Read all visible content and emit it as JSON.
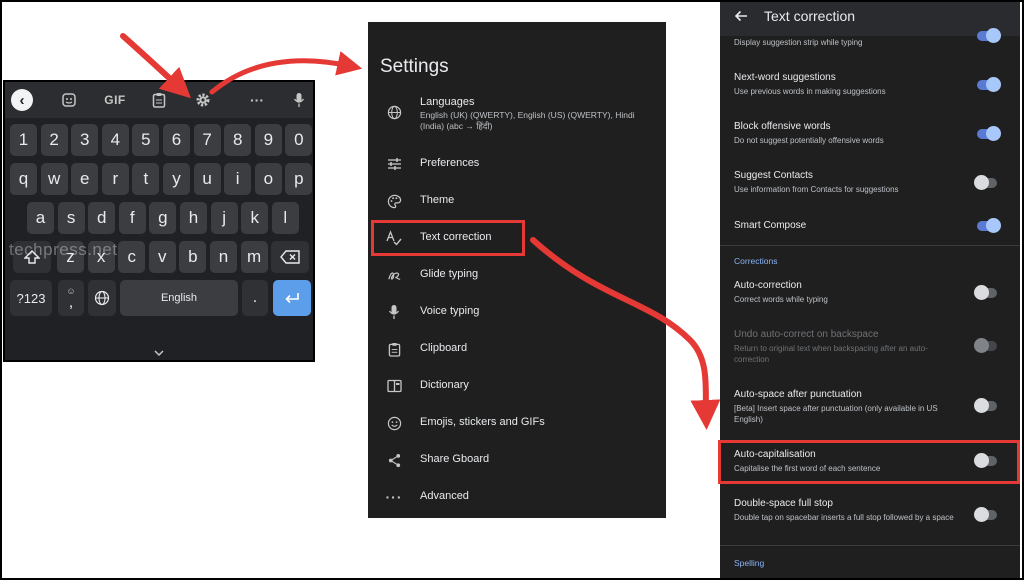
{
  "keyboard": {
    "toolbar": {
      "back_icon": "back-arrow-icon",
      "sticker_icon": "sticker-icon",
      "gif_label": "GIF",
      "clipboard_icon": "clipboard-icon",
      "settings_icon": "gear-icon",
      "more_label": "···",
      "mic_icon": "mic-icon"
    },
    "watermark": "techpress.net",
    "numbers": [
      "1",
      "2",
      "3",
      "4",
      "5",
      "6",
      "7",
      "8",
      "9",
      "0"
    ],
    "row1": [
      "q",
      "w",
      "e",
      "r",
      "t",
      "y",
      "u",
      "i",
      "o",
      "p"
    ],
    "row2": [
      "a",
      "s",
      "d",
      "f",
      "g",
      "h",
      "j",
      "k",
      "l"
    ],
    "row3": [
      "z",
      "x",
      "c",
      "v",
      "b",
      "n",
      "m"
    ],
    "sym_label": "?123",
    "emoji_comma": ",",
    "space_label": "English",
    "period_label": ".",
    "accent_color": "#5c9eea"
  },
  "settings": {
    "title": "Settings",
    "items": [
      {
        "label": "Languages",
        "sub": "English (UK) (QWERTY), English (US) (QWERTY), Hindi (India) (abc → हिंदी)",
        "icon": "globe-icon"
      },
      {
        "label": "Preferences",
        "icon": "sliders-icon"
      },
      {
        "label": "Theme",
        "icon": "palette-icon"
      },
      {
        "label": "Text correction",
        "icon": "spellcheck-icon"
      },
      {
        "label": "Glide typing",
        "icon": "glide-icon"
      },
      {
        "label": "Voice typing",
        "icon": "mic-icon"
      },
      {
        "label": "Clipboard",
        "icon": "clipboard-icon"
      },
      {
        "label": "Dictionary",
        "icon": "book-icon"
      },
      {
        "label": "Emojis, stickers and GIFs",
        "icon": "emoji-icon"
      },
      {
        "label": "Share Gboard",
        "icon": "share-icon"
      },
      {
        "label": "Advanced",
        "icon": "more-icon"
      }
    ]
  },
  "text_correction": {
    "title": "Text correction",
    "top_partial_sub": "Display suggestion strip while typing",
    "items": [
      {
        "label": "Next-word suggestions",
        "sub": "Use previous words in making suggestions",
        "on": true
      },
      {
        "label": "Block offensive words",
        "sub": "Do not suggest potentially offensive words",
        "on": true
      },
      {
        "label": "Suggest Contacts",
        "sub": "Use information from Contacts for suggestions",
        "on": false
      },
      {
        "label": "Smart Compose",
        "sub": "",
        "on": true
      }
    ],
    "corrections_header": "Corrections",
    "corrections": [
      {
        "label": "Auto-correction",
        "sub": "Correct words while typing",
        "on": false
      },
      {
        "label": "Undo auto-correct on backspace",
        "sub": "Return to original text when backspacing after an auto-correction",
        "on": false,
        "disabled": true
      },
      {
        "label": "Auto-space after punctuation",
        "sub": "[Beta] Insert space after punctuation (only available in US English)",
        "on": false
      },
      {
        "label": "Auto-capitalisation",
        "sub": "Capitalise the first word of each sentence",
        "on": false
      },
      {
        "label": "Double-space full stop",
        "sub": "Double tap on spacebar inserts a full stop followed by a space",
        "on": false
      }
    ],
    "spelling_header": "Spelling"
  },
  "colors": {
    "highlight": "#e53935",
    "toggle_on": "#a8c7fa",
    "section": "#8ab4f8"
  }
}
